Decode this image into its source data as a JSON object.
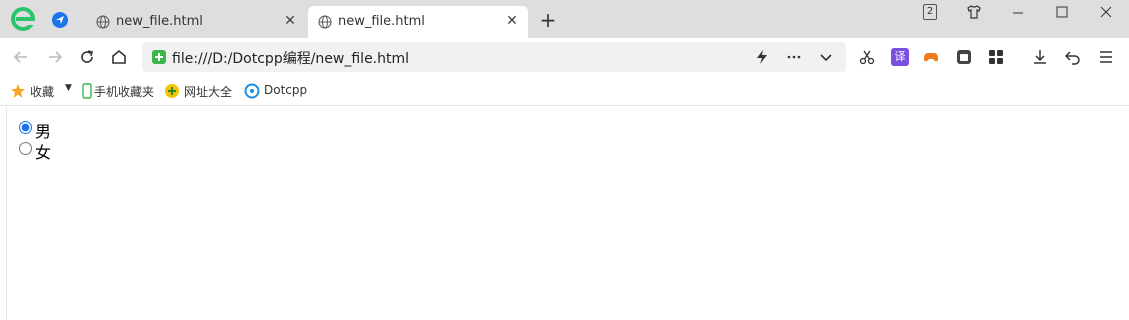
{
  "tabs": [
    {
      "title": "new_file.html",
      "active": false
    },
    {
      "title": "new_file.html",
      "active": true
    }
  ],
  "window_badge": "2",
  "address_bar": {
    "url": "file:///D:/Dotcpp编程/new_file.html"
  },
  "extensions": {
    "translate_label": "译"
  },
  "bookmarks": [
    {
      "label": "收藏",
      "icon": "star-icon"
    },
    {
      "label": "手机收藏夹",
      "icon": "phone-icon"
    },
    {
      "label": "网址大全",
      "icon": "plus-circle-icon"
    },
    {
      "label": "Dotcpp",
      "icon": "dotcpp-logo-icon"
    }
  ],
  "form": {
    "options": [
      {
        "label": "男",
        "checked": true
      },
      {
        "label": "女",
        "checked": false
      }
    ]
  },
  "colors": {
    "accent": "#1a73e8",
    "tabstrip": "#dedede",
    "logo_green": "#2bc46b"
  }
}
